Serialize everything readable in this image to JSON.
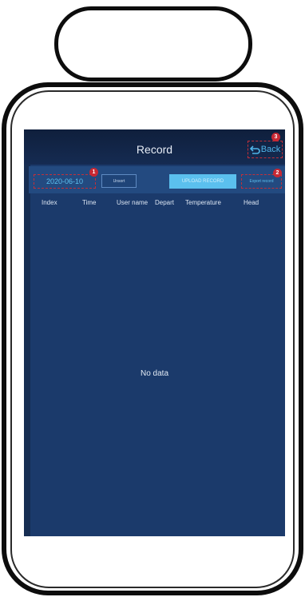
{
  "header": {
    "title": "Record",
    "back_label": "Back",
    "back_icon": "back-arrow-icon"
  },
  "toolbar": {
    "date_value": "2020-06-10",
    "unsort_label": "Unsort",
    "upload_label": "UPLOAD RECORD",
    "export_label": "Export record"
  },
  "badges": {
    "date": "1",
    "export": "2",
    "back": "3"
  },
  "table": {
    "columns": [
      "Index",
      "Time",
      "User name",
      "Depart",
      "Temperature",
      "Head"
    ],
    "rows": [],
    "empty_text": "No data"
  },
  "colors": {
    "screen_bg": "#1b3a6b",
    "accent": "#5bc0ee",
    "annotation_red": "#c82833"
  }
}
